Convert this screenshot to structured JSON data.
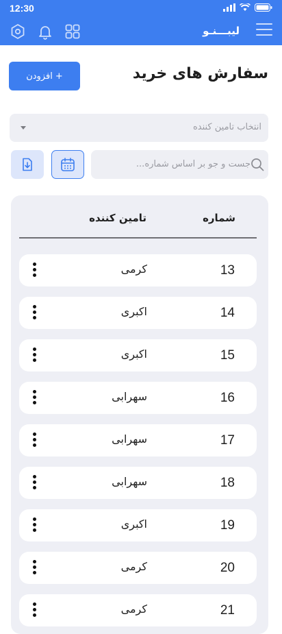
{
  "status": {
    "time": "12:30"
  },
  "header": {
    "app_name": "لیبـــنـو",
    "bg_color": "#3d7ef0"
  },
  "page": {
    "title": "سفارش های خرید",
    "add_label": "+ افزودن"
  },
  "filters": {
    "supplier_placeholder": "انتخاب تامین کننده",
    "search_placeholder": "جست و جو بر اساس شماره..."
  },
  "table": {
    "columns": [
      "شماره",
      "تامین کننده"
    ],
    "rows": [
      {
        "number": "13",
        "supplier": "کرمی"
      },
      {
        "number": "14",
        "supplier": "اکبری"
      },
      {
        "number": "15",
        "supplier": "اکبری"
      },
      {
        "number": "16",
        "supplier": "سهرابی"
      },
      {
        "number": "17",
        "supplier": "سهرابی"
      },
      {
        "number": "18",
        "supplier": "سهرابی"
      },
      {
        "number": "19",
        "supplier": "اکبری"
      },
      {
        "number": "20",
        "supplier": "کرمی"
      },
      {
        "number": "21",
        "supplier": "کرمی"
      }
    ]
  },
  "icons": [
    "settings-hex-icon",
    "bell-icon",
    "grid-icon",
    "menu-icon",
    "download-icon",
    "calendar-icon",
    "search-icon",
    "more-vertical-icon"
  ]
}
